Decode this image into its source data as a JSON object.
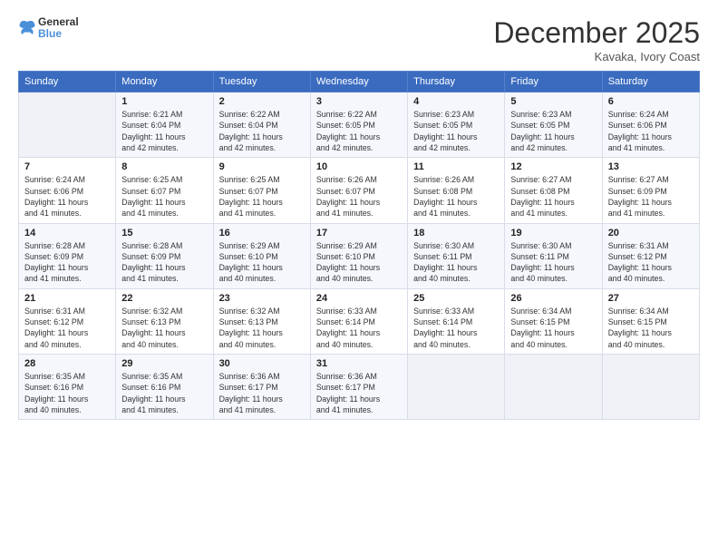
{
  "header": {
    "logo_line1": "General",
    "logo_line2": "Blue",
    "month": "December 2025",
    "location": "Kavaka, Ivory Coast"
  },
  "days_of_week": [
    "Sunday",
    "Monday",
    "Tuesday",
    "Wednesday",
    "Thursday",
    "Friday",
    "Saturday"
  ],
  "weeks": [
    [
      {
        "num": "",
        "info": ""
      },
      {
        "num": "1",
        "info": "Sunrise: 6:21 AM\nSunset: 6:04 PM\nDaylight: 11 hours\nand 42 minutes."
      },
      {
        "num": "2",
        "info": "Sunrise: 6:22 AM\nSunset: 6:04 PM\nDaylight: 11 hours\nand 42 minutes."
      },
      {
        "num": "3",
        "info": "Sunrise: 6:22 AM\nSunset: 6:05 PM\nDaylight: 11 hours\nand 42 minutes."
      },
      {
        "num": "4",
        "info": "Sunrise: 6:23 AM\nSunset: 6:05 PM\nDaylight: 11 hours\nand 42 minutes."
      },
      {
        "num": "5",
        "info": "Sunrise: 6:23 AM\nSunset: 6:05 PM\nDaylight: 11 hours\nand 42 minutes."
      },
      {
        "num": "6",
        "info": "Sunrise: 6:24 AM\nSunset: 6:06 PM\nDaylight: 11 hours\nand 41 minutes."
      }
    ],
    [
      {
        "num": "7",
        "info": "Sunrise: 6:24 AM\nSunset: 6:06 PM\nDaylight: 11 hours\nand 41 minutes."
      },
      {
        "num": "8",
        "info": "Sunrise: 6:25 AM\nSunset: 6:07 PM\nDaylight: 11 hours\nand 41 minutes."
      },
      {
        "num": "9",
        "info": "Sunrise: 6:25 AM\nSunset: 6:07 PM\nDaylight: 11 hours\nand 41 minutes."
      },
      {
        "num": "10",
        "info": "Sunrise: 6:26 AM\nSunset: 6:07 PM\nDaylight: 11 hours\nand 41 minutes."
      },
      {
        "num": "11",
        "info": "Sunrise: 6:26 AM\nSunset: 6:08 PM\nDaylight: 11 hours\nand 41 minutes."
      },
      {
        "num": "12",
        "info": "Sunrise: 6:27 AM\nSunset: 6:08 PM\nDaylight: 11 hours\nand 41 minutes."
      },
      {
        "num": "13",
        "info": "Sunrise: 6:27 AM\nSunset: 6:09 PM\nDaylight: 11 hours\nand 41 minutes."
      }
    ],
    [
      {
        "num": "14",
        "info": "Sunrise: 6:28 AM\nSunset: 6:09 PM\nDaylight: 11 hours\nand 41 minutes."
      },
      {
        "num": "15",
        "info": "Sunrise: 6:28 AM\nSunset: 6:09 PM\nDaylight: 11 hours\nand 41 minutes."
      },
      {
        "num": "16",
        "info": "Sunrise: 6:29 AM\nSunset: 6:10 PM\nDaylight: 11 hours\nand 40 minutes."
      },
      {
        "num": "17",
        "info": "Sunrise: 6:29 AM\nSunset: 6:10 PM\nDaylight: 11 hours\nand 40 minutes."
      },
      {
        "num": "18",
        "info": "Sunrise: 6:30 AM\nSunset: 6:11 PM\nDaylight: 11 hours\nand 40 minutes."
      },
      {
        "num": "19",
        "info": "Sunrise: 6:30 AM\nSunset: 6:11 PM\nDaylight: 11 hours\nand 40 minutes."
      },
      {
        "num": "20",
        "info": "Sunrise: 6:31 AM\nSunset: 6:12 PM\nDaylight: 11 hours\nand 40 minutes."
      }
    ],
    [
      {
        "num": "21",
        "info": "Sunrise: 6:31 AM\nSunset: 6:12 PM\nDaylight: 11 hours\nand 40 minutes."
      },
      {
        "num": "22",
        "info": "Sunrise: 6:32 AM\nSunset: 6:13 PM\nDaylight: 11 hours\nand 40 minutes."
      },
      {
        "num": "23",
        "info": "Sunrise: 6:32 AM\nSunset: 6:13 PM\nDaylight: 11 hours\nand 40 minutes."
      },
      {
        "num": "24",
        "info": "Sunrise: 6:33 AM\nSunset: 6:14 PM\nDaylight: 11 hours\nand 40 minutes."
      },
      {
        "num": "25",
        "info": "Sunrise: 6:33 AM\nSunset: 6:14 PM\nDaylight: 11 hours\nand 40 minutes."
      },
      {
        "num": "26",
        "info": "Sunrise: 6:34 AM\nSunset: 6:15 PM\nDaylight: 11 hours\nand 40 minutes."
      },
      {
        "num": "27",
        "info": "Sunrise: 6:34 AM\nSunset: 6:15 PM\nDaylight: 11 hours\nand 40 minutes."
      }
    ],
    [
      {
        "num": "28",
        "info": "Sunrise: 6:35 AM\nSunset: 6:16 PM\nDaylight: 11 hours\nand 40 minutes."
      },
      {
        "num": "29",
        "info": "Sunrise: 6:35 AM\nSunset: 6:16 PM\nDaylight: 11 hours\nand 41 minutes."
      },
      {
        "num": "30",
        "info": "Sunrise: 6:36 AM\nSunset: 6:17 PM\nDaylight: 11 hours\nand 41 minutes."
      },
      {
        "num": "31",
        "info": "Sunrise: 6:36 AM\nSunset: 6:17 PM\nDaylight: 11 hours\nand 41 minutes."
      },
      {
        "num": "",
        "info": ""
      },
      {
        "num": "",
        "info": ""
      },
      {
        "num": "",
        "info": ""
      }
    ]
  ]
}
